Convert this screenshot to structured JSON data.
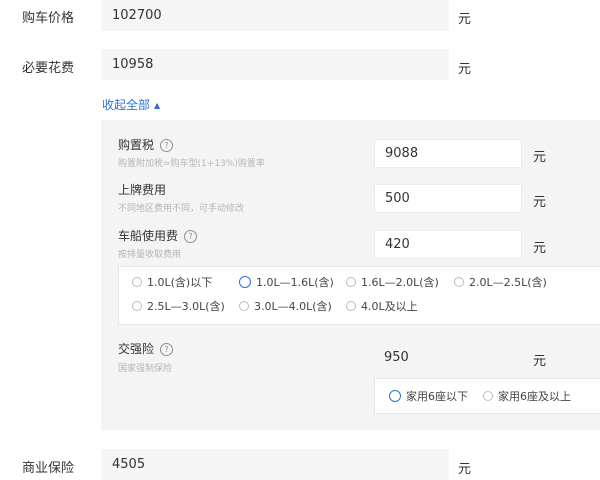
{
  "rows": {
    "price": {
      "label": "购车价格",
      "value": "102700",
      "unit": "元"
    },
    "required": {
      "label": "必要花费",
      "value": "10958",
      "unit": "元"
    },
    "insurance": {
      "label": "商业保险",
      "value": "4505",
      "unit": "元"
    }
  },
  "collapse": {
    "label": "收起全部",
    "icon": "caret-up-icon"
  },
  "details": {
    "purchase_tax": {
      "title": "购置税",
      "hint": "购置附加税=购车型(1+13%)购置率",
      "value": "9088",
      "unit": "元"
    },
    "plate_fee": {
      "title": "上牌费用",
      "hint": "不同地区费用不同，可手动修改",
      "value": "500",
      "unit": "元"
    },
    "vessel_tax": {
      "title": "车船使用费",
      "hint": "按排量收取费用",
      "value": "420",
      "unit": "元",
      "options": [
        "1.0L(含)以下",
        "1.0L—1.6L(含)",
        "1.6L—2.0L(含)",
        "2.0L—2.5L(含)",
        "2.5L—3.0L(含)",
        "3.0L—4.0L(含)",
        "4.0L及以上"
      ],
      "selected": "1.0L—1.6L(含)"
    },
    "compulsory": {
      "title": "交强险",
      "hint": "国家强制保险",
      "value": "950",
      "unit": "元",
      "options": [
        "家用6座以下",
        "家用6座及以上"
      ],
      "selected": "家用6座以下"
    }
  },
  "colors": {
    "accent": "#2a6fd6",
    "field_bg": "#f5f5f5",
    "panel_bg": "#f4f4f5"
  }
}
